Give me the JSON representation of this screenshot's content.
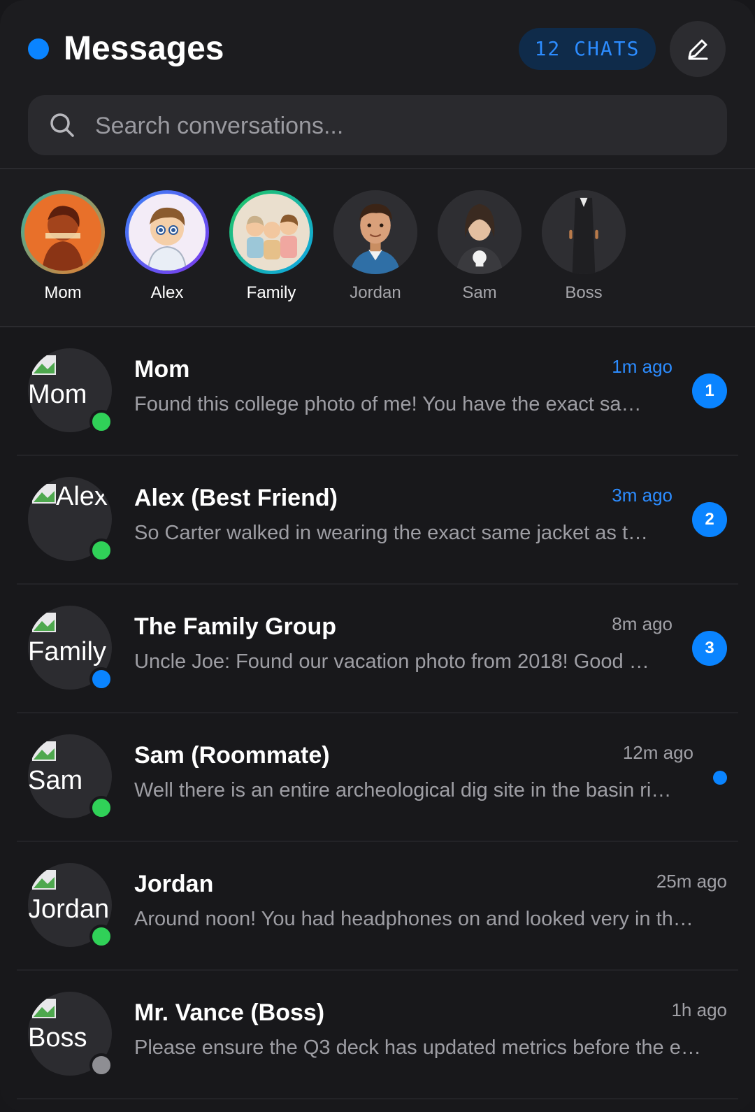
{
  "header": {
    "title": "Messages",
    "chats_pill": "12 CHATS",
    "accent": "#0a84ff"
  },
  "search": {
    "placeholder": "Search conversations..."
  },
  "stories": [
    {
      "label": "Mom",
      "ring": "gradient-teal-orange",
      "active": true
    },
    {
      "label": "Alex",
      "ring": "gradient-blue-purple",
      "active": true
    },
    {
      "label": "Family",
      "ring": "gradient-green-blue",
      "active": true
    },
    {
      "label": "Jordan",
      "ring": "none",
      "active": false
    },
    {
      "label": "Sam",
      "ring": "none",
      "active": false
    },
    {
      "label": "Boss",
      "ring": "none",
      "active": false
    }
  ],
  "conversations": [
    {
      "avatar_alt": "Mom",
      "name": "Mom",
      "time": "1m ago",
      "time_color": "blue",
      "preview": "Found this college photo of me! You have the exact sa…",
      "badge": "1",
      "status": "#30d158"
    },
    {
      "avatar_alt": "Alex",
      "name": "Alex (Best Friend)",
      "time": "3m ago",
      "time_color": "blue",
      "preview": "So Carter walked in wearing the exact same jacket as t…",
      "badge": "2",
      "status": "#30d158"
    },
    {
      "avatar_alt": "Family",
      "name": "The Family Group",
      "time": "8m ago",
      "time_color": "gray",
      "preview": "Uncle Joe: Found our vacation photo from 2018! Good …",
      "badge": "3",
      "status": "#0a84ff"
    },
    {
      "avatar_alt": "Sam",
      "name": "Sam (Roommate)",
      "time": "12m ago",
      "time_color": "gray",
      "preview": "Well there is an entire archeological dig site in the basin ri…",
      "badge": "",
      "unread_dot": true,
      "status": "#30d158"
    },
    {
      "avatar_alt": "Jordan",
      "name": "Jordan",
      "time": "25m ago",
      "time_color": "gray",
      "preview": "Around noon! You had headphones on and looked very in th…",
      "badge": "",
      "status": "#30d158"
    },
    {
      "avatar_alt": "Boss",
      "name": "Mr. Vance (Boss)",
      "time": "1h ago",
      "time_color": "gray",
      "preview": "Please ensure the Q3 deck has updated metrics before the e…",
      "badge": "",
      "status": "#8e8e93"
    }
  ]
}
